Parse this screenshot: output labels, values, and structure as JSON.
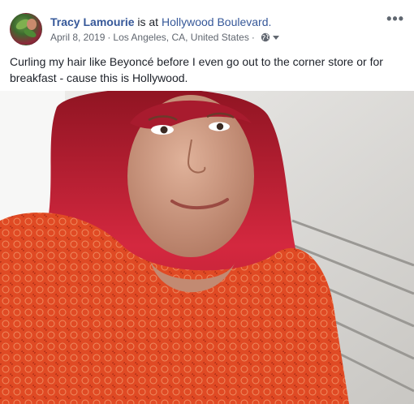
{
  "post": {
    "author": "Tracy Lamourie",
    "verb": "is at",
    "place": "Hollywood Boulevard.",
    "date": "April 8, 2019",
    "separator": "·",
    "location": "Los Angeles, CA, United States",
    "separator2": "·",
    "more_label": "•••",
    "caption": "Curling my hair like Beyoncé before I even go out to the corner store or for breakfast - cause this is Hollywood."
  },
  "icons": {
    "avatar": "profile-photo",
    "privacy": "globe-icon",
    "dropdown": "caret-down-icon",
    "menu": "more-options-icon"
  },
  "colors": {
    "name_link": "#365899",
    "meta_text": "#616770",
    "body_text": "#1d2129",
    "hair": "#c8243a",
    "dress": "#e04a24"
  }
}
